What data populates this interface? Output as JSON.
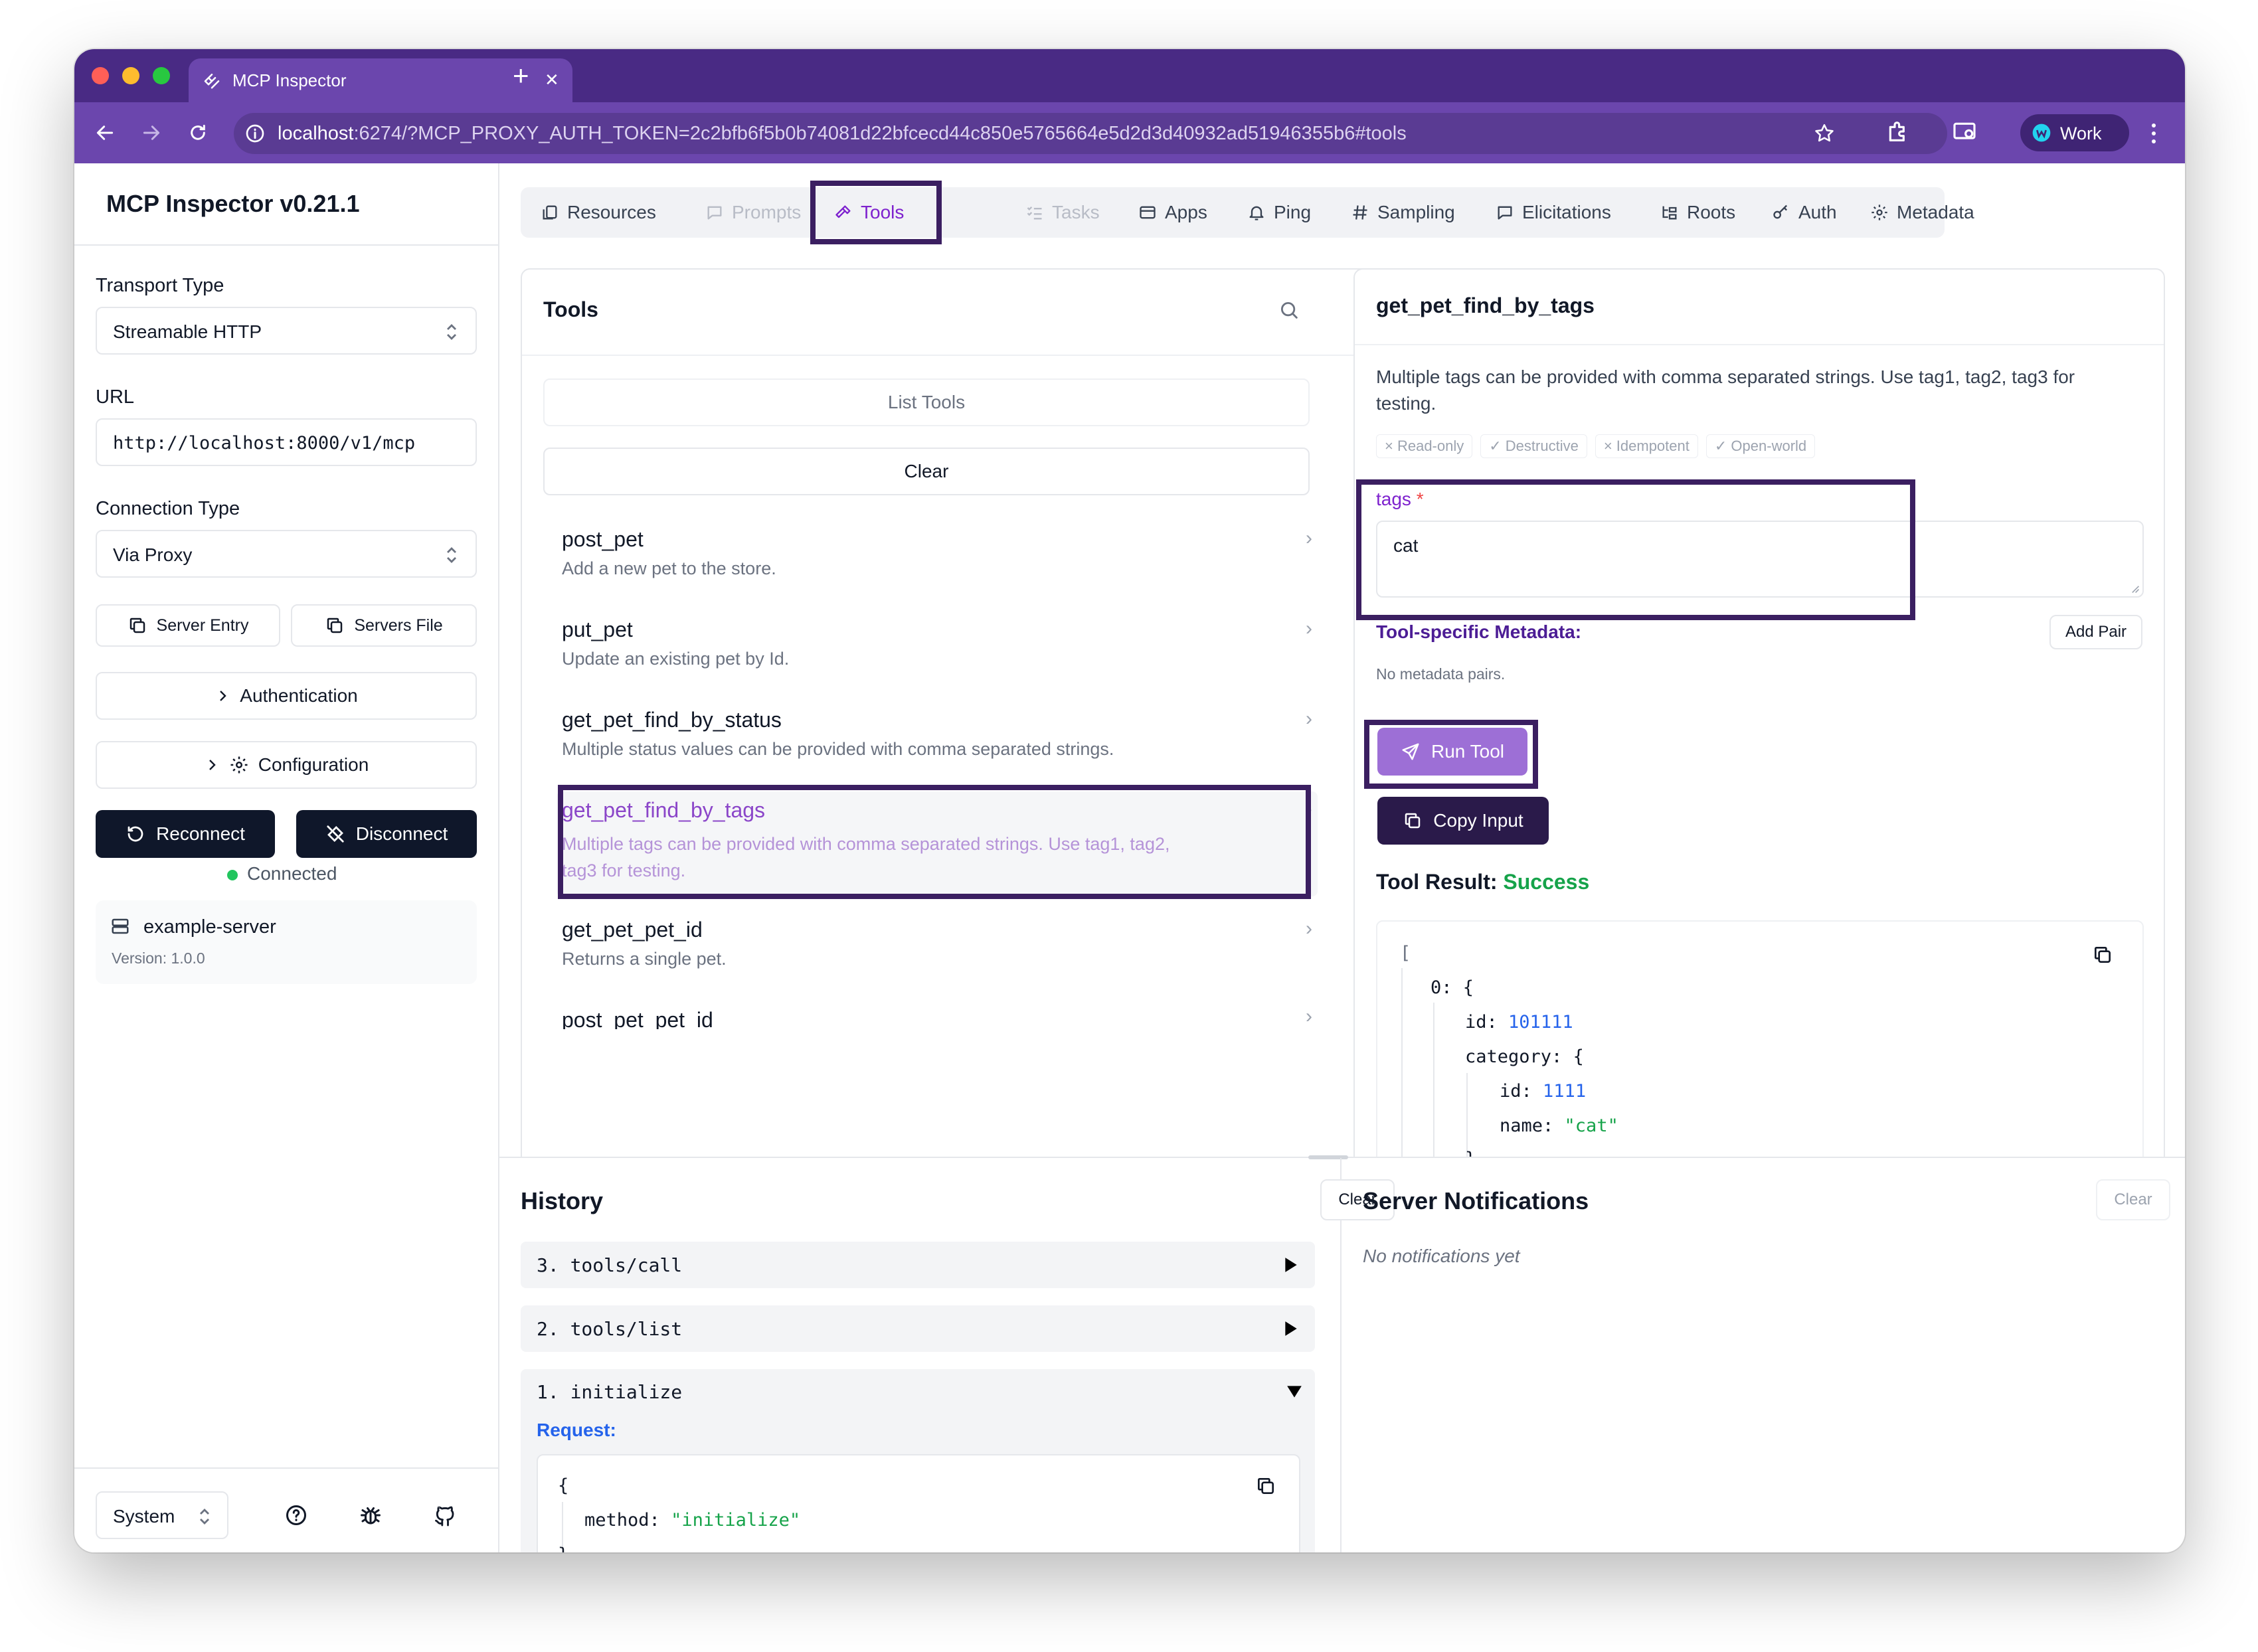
{
  "browser": {
    "tab_title": "MCP Inspector",
    "new_tab_symbol": "+",
    "close_symbol": "✕",
    "url_host": "localhost",
    "url_rest": ":6274/?MCP_PROXY_AUTH_TOKEN=2c2bfb6f5b0b74081d22bfcecd44c850e5765664e5d2d3d40932ad51946355b6#tools",
    "profile": "Work"
  },
  "sidebar": {
    "title": "MCP Inspector v0.21.1",
    "transport_label": "Transport Type",
    "transport_value": "Streamable HTTP",
    "url_label": "URL",
    "url_value": "http://localhost:8000/v1/mcp",
    "conn_label": "Connection Type",
    "conn_value": "Via Proxy",
    "server_entry": "Server Entry",
    "servers_file": "Servers File",
    "authentication": "Authentication",
    "configuration": "Configuration",
    "reconnect": "Reconnect",
    "disconnect": "Disconnect",
    "status": "Connected",
    "server_name": "example-server",
    "server_version": "Version: 1.0.0",
    "theme": "System"
  },
  "tabs": [
    "Resources",
    "Prompts",
    "Tools",
    "Tasks",
    "Apps",
    "Ping",
    "Sampling",
    "Elicitations",
    "Roots",
    "Auth",
    "Metadata"
  ],
  "tools_panel": {
    "title": "Tools",
    "list_tools": "List Tools",
    "clear": "Clear",
    "items": [
      {
        "name": "post_pet",
        "desc": "Add a new pet to the store."
      },
      {
        "name": "put_pet",
        "desc": "Update an existing pet by Id."
      },
      {
        "name": "get_pet_find_by_status",
        "desc": "Multiple status values can be provided with comma separated strings."
      },
      {
        "name": "get_pet_find_by_tags",
        "desc1": "Multiple tags can be provided with comma separated strings. Use tag1, tag2,",
        "desc2": "tag3 for testing."
      },
      {
        "name": "get_pet_pet_id",
        "desc": "Returns a single pet."
      },
      {
        "name": "post_pet_pet_id"
      }
    ]
  },
  "detail": {
    "title": "get_pet_find_by_tags",
    "desc1": "Multiple tags can be provided with comma separated strings. Use tag1, tag2, tag3 for",
    "desc2": "testing.",
    "annotations": [
      "× Read-only",
      "✓ Destructive",
      "× Idempotent",
      "✓ Open-world"
    ],
    "tags_label": "tags",
    "required_mark": "*",
    "tags_value": "cat",
    "meta_label": "Tool-specific Metadata:",
    "add_pair": "Add Pair",
    "no_meta": "No metadata pairs.",
    "run_tool": "Run Tool",
    "copy_input": "Copy Input",
    "result_label": "Tool Result:",
    "result_status": "Success",
    "json": {
      "open": "[",
      "k0": "0:",
      "brace": "{",
      "id_key": "id:",
      "id_val": "101111",
      "cat_key": "category:",
      "cat_id_key": "id:",
      "cat_id_val": "1111",
      "name_key": "name:",
      "name_val": "\"cat\"",
      "close": "}"
    }
  },
  "history": {
    "title": "History",
    "clear": "Clear",
    "items": [
      "3. tools/call",
      "2. tools/list",
      "1. initialize"
    ],
    "request_label": "Request:",
    "req_open": "{",
    "req_method_key": "method:",
    "req_method_val": "\"initialize\"",
    "req_close": "}"
  },
  "notifications": {
    "title": "Server Notifications",
    "clear": "Clear",
    "empty": "No notifications yet"
  },
  "colors": {
    "titlebar": "#492a84",
    "toolbar": "#6b46ad",
    "accent": "#7e22ce",
    "highlight": "#3b1f61",
    "run_button": "#9d6fd6",
    "success": "#16a34a"
  }
}
